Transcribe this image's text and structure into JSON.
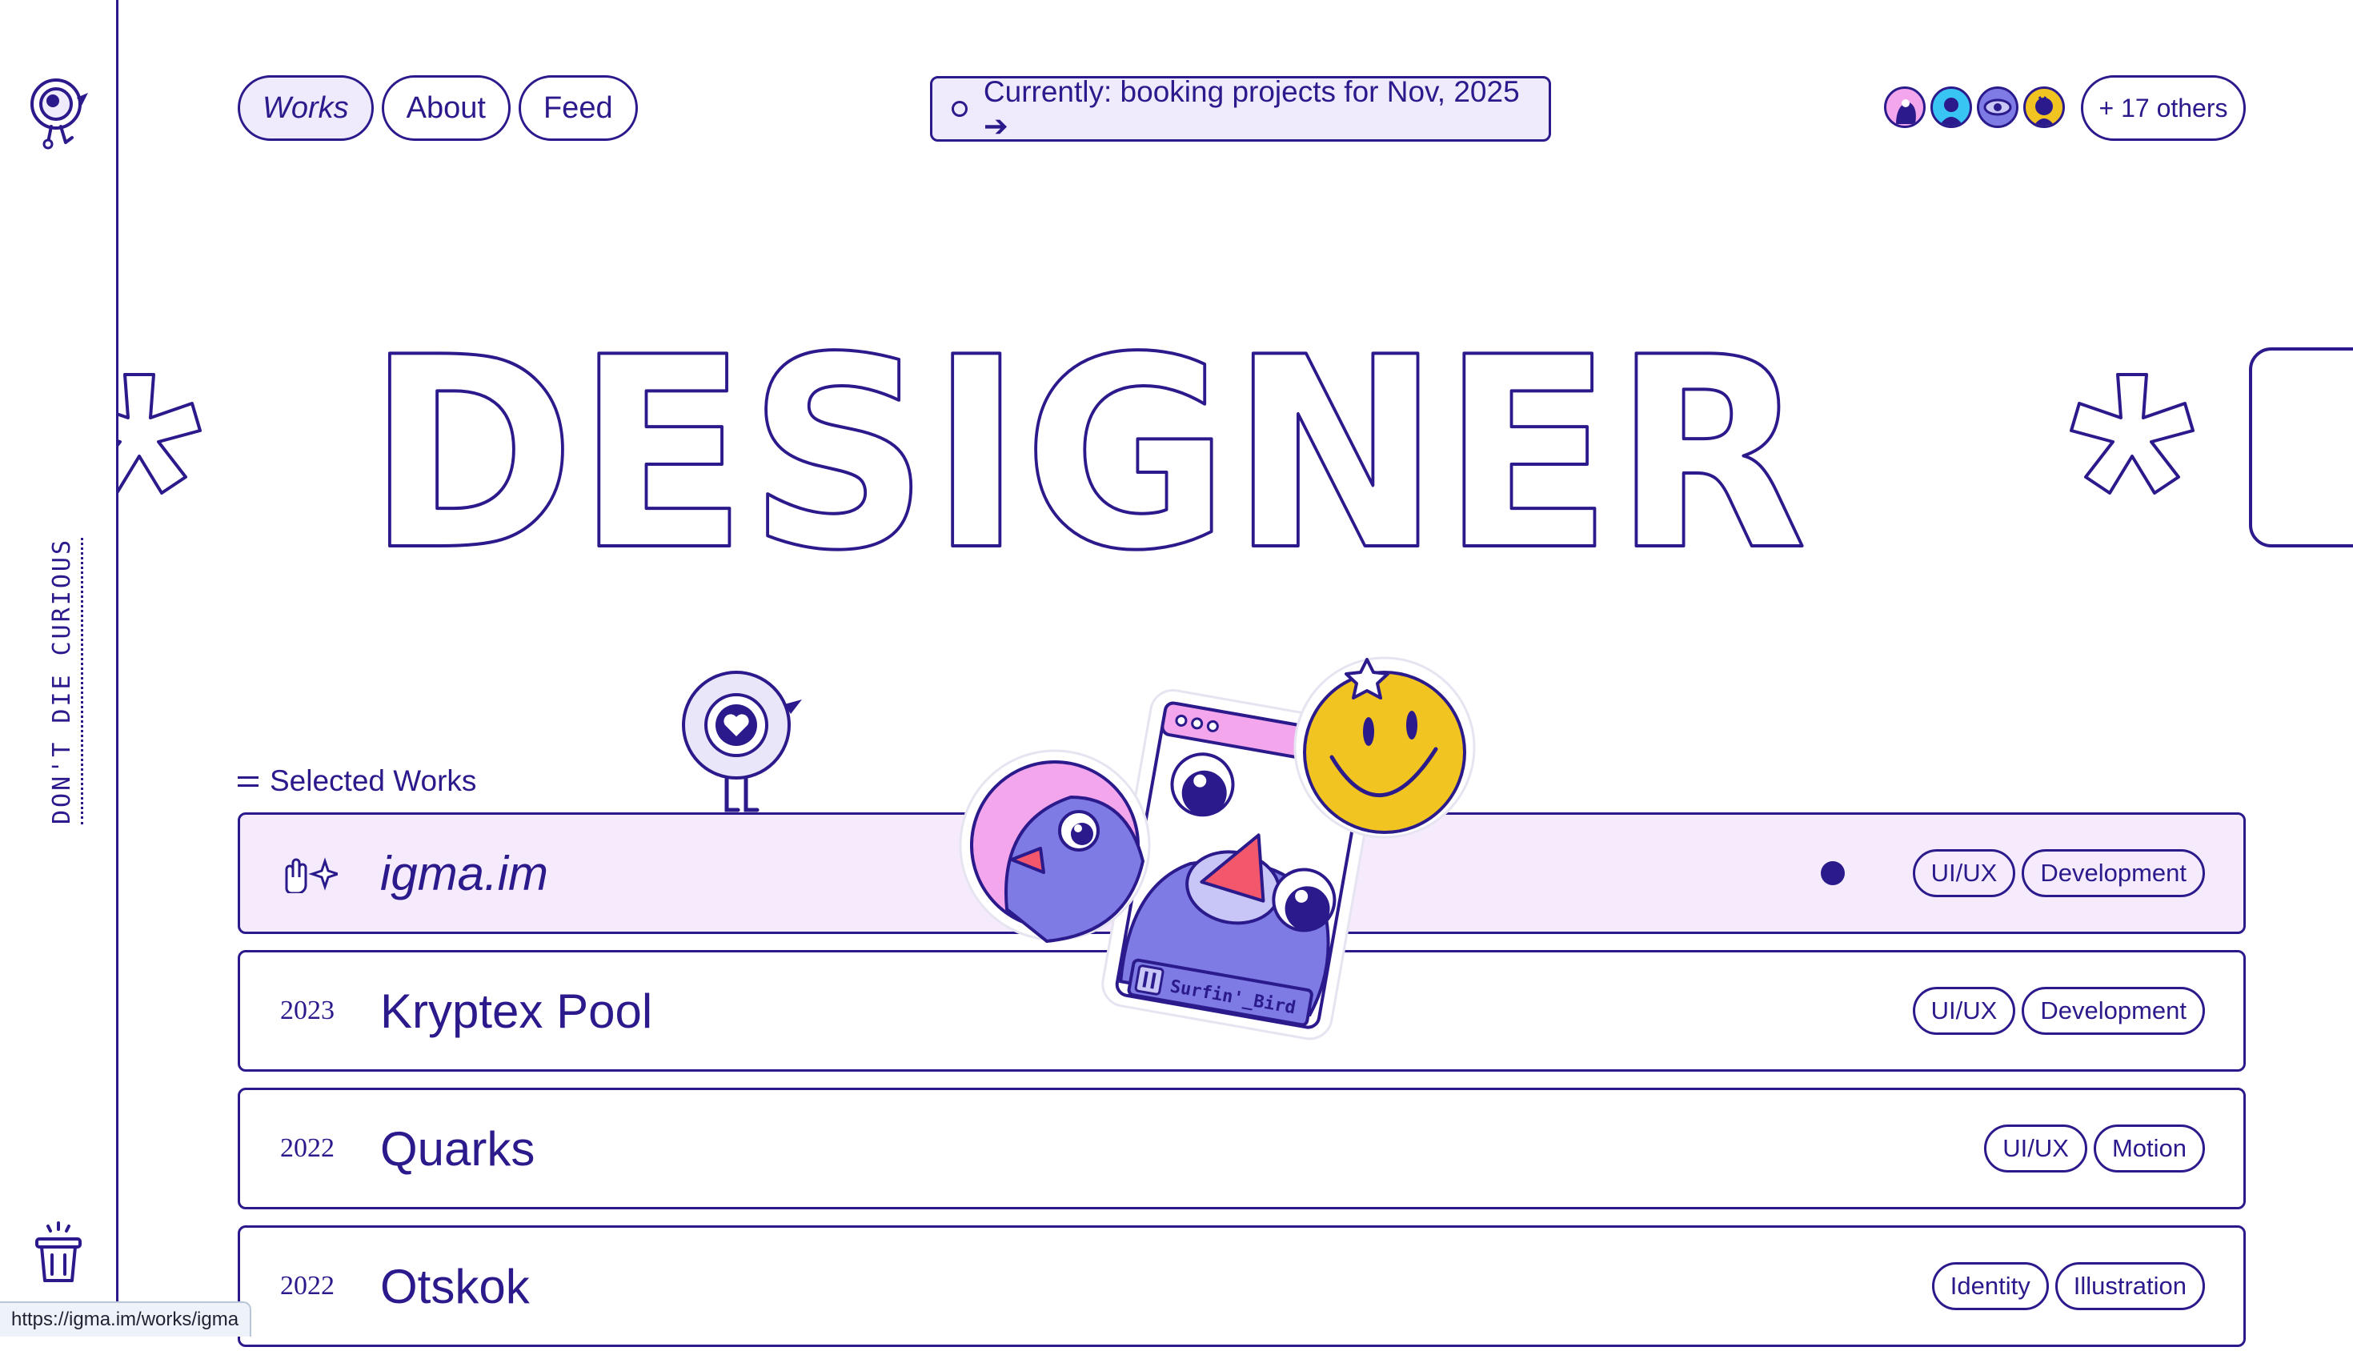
{
  "rail": {
    "tagline": "Don't die curious"
  },
  "nav": {
    "items": [
      {
        "label": "Works"
      },
      {
        "label": "About"
      },
      {
        "label": "Feed"
      }
    ]
  },
  "status": {
    "text": "Currently: booking projects for Nov, 2025 ➔"
  },
  "visitors": {
    "others_label": "+ 17 others"
  },
  "hero": {
    "marquee_text": "DESIGNER"
  },
  "section": {
    "title": "Selected Works"
  },
  "works": [
    {
      "year": "",
      "title": "igma.im",
      "tags": [
        "UI/UX",
        "Development"
      ]
    },
    {
      "year": "2023",
      "title": "Kryptex Pool",
      "tags": [
        "UI/UX",
        "Development"
      ]
    },
    {
      "year": "2022",
      "title": "Quarks",
      "tags": [
        "UI/UX",
        "Motion"
      ]
    },
    {
      "year": "2022",
      "title": "Otskok",
      "tags": [
        "Identity",
        "Illustration"
      ]
    }
  ],
  "sticker": {
    "window_label": "Surfin'_Bird"
  },
  "statusbar": {
    "url": "https://igma.im/works/igma"
  },
  "colors": {
    "ink": "#2b1a8c",
    "hover_row": "#f5ebfd",
    "pill_active": "#efeafc",
    "smiley": "#f2c422",
    "bird": "#7e7be4",
    "pink": "#f4a6ec"
  }
}
